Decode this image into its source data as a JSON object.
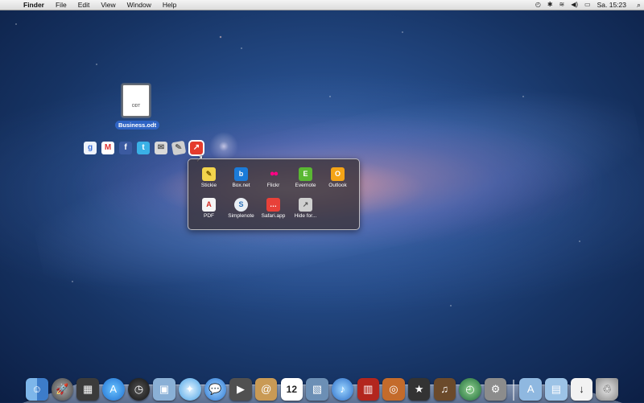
{
  "menubar": {
    "apple_icon": "apple-logo",
    "app_name": "Finder",
    "menus": [
      "File",
      "Edit",
      "View",
      "Window",
      "Help"
    ],
    "status_icons": [
      "time-machine-icon",
      "bluetooth-icon",
      "wifi-icon",
      "volume-icon",
      "battery-icon"
    ],
    "clock": "Sa. 15:23"
  },
  "desktop": {
    "file": {
      "ext": "ODT",
      "name": "Business.odt"
    }
  },
  "share_strip": {
    "services": [
      "google",
      "gmail",
      "facebook",
      "twitter",
      "mail",
      "notes",
      "share-active"
    ]
  },
  "popover": {
    "items": [
      {
        "label": "Stickie",
        "icon": "stickie-icon"
      },
      {
        "label": "Box.net",
        "icon": "box-icon"
      },
      {
        "label": "Flickr",
        "icon": "flickr-icon"
      },
      {
        "label": "Evernote",
        "icon": "evernote-icon"
      },
      {
        "label": "Outlook",
        "icon": "outlook-icon"
      },
      {
        "label": "PDF",
        "icon": "pdf-icon"
      },
      {
        "label": "Simplenote",
        "icon": "simplenote-icon"
      },
      {
        "label": "Safari.app",
        "icon": "safari-icon"
      },
      {
        "label": "Hide for...",
        "icon": "hide-icon"
      }
    ]
  },
  "dock": {
    "ical_day": "12",
    "apps": [
      "finder",
      "launchpad",
      "mission-control",
      "app-store",
      "dashboard",
      "preview",
      "safari",
      "ichat",
      "facetime",
      "contacts",
      "ical",
      "iphoto",
      "itunes",
      "photo-booth",
      "aperture",
      "imovie",
      "garageband",
      "time-machine",
      "system-preferences"
    ],
    "stacks": [
      "applications",
      "documents",
      "downloads",
      "trash"
    ]
  },
  "colors": {
    "menubar": "#e6e6e6",
    "selection": "#2f64c4",
    "popover_bg": "#3a343c"
  }
}
